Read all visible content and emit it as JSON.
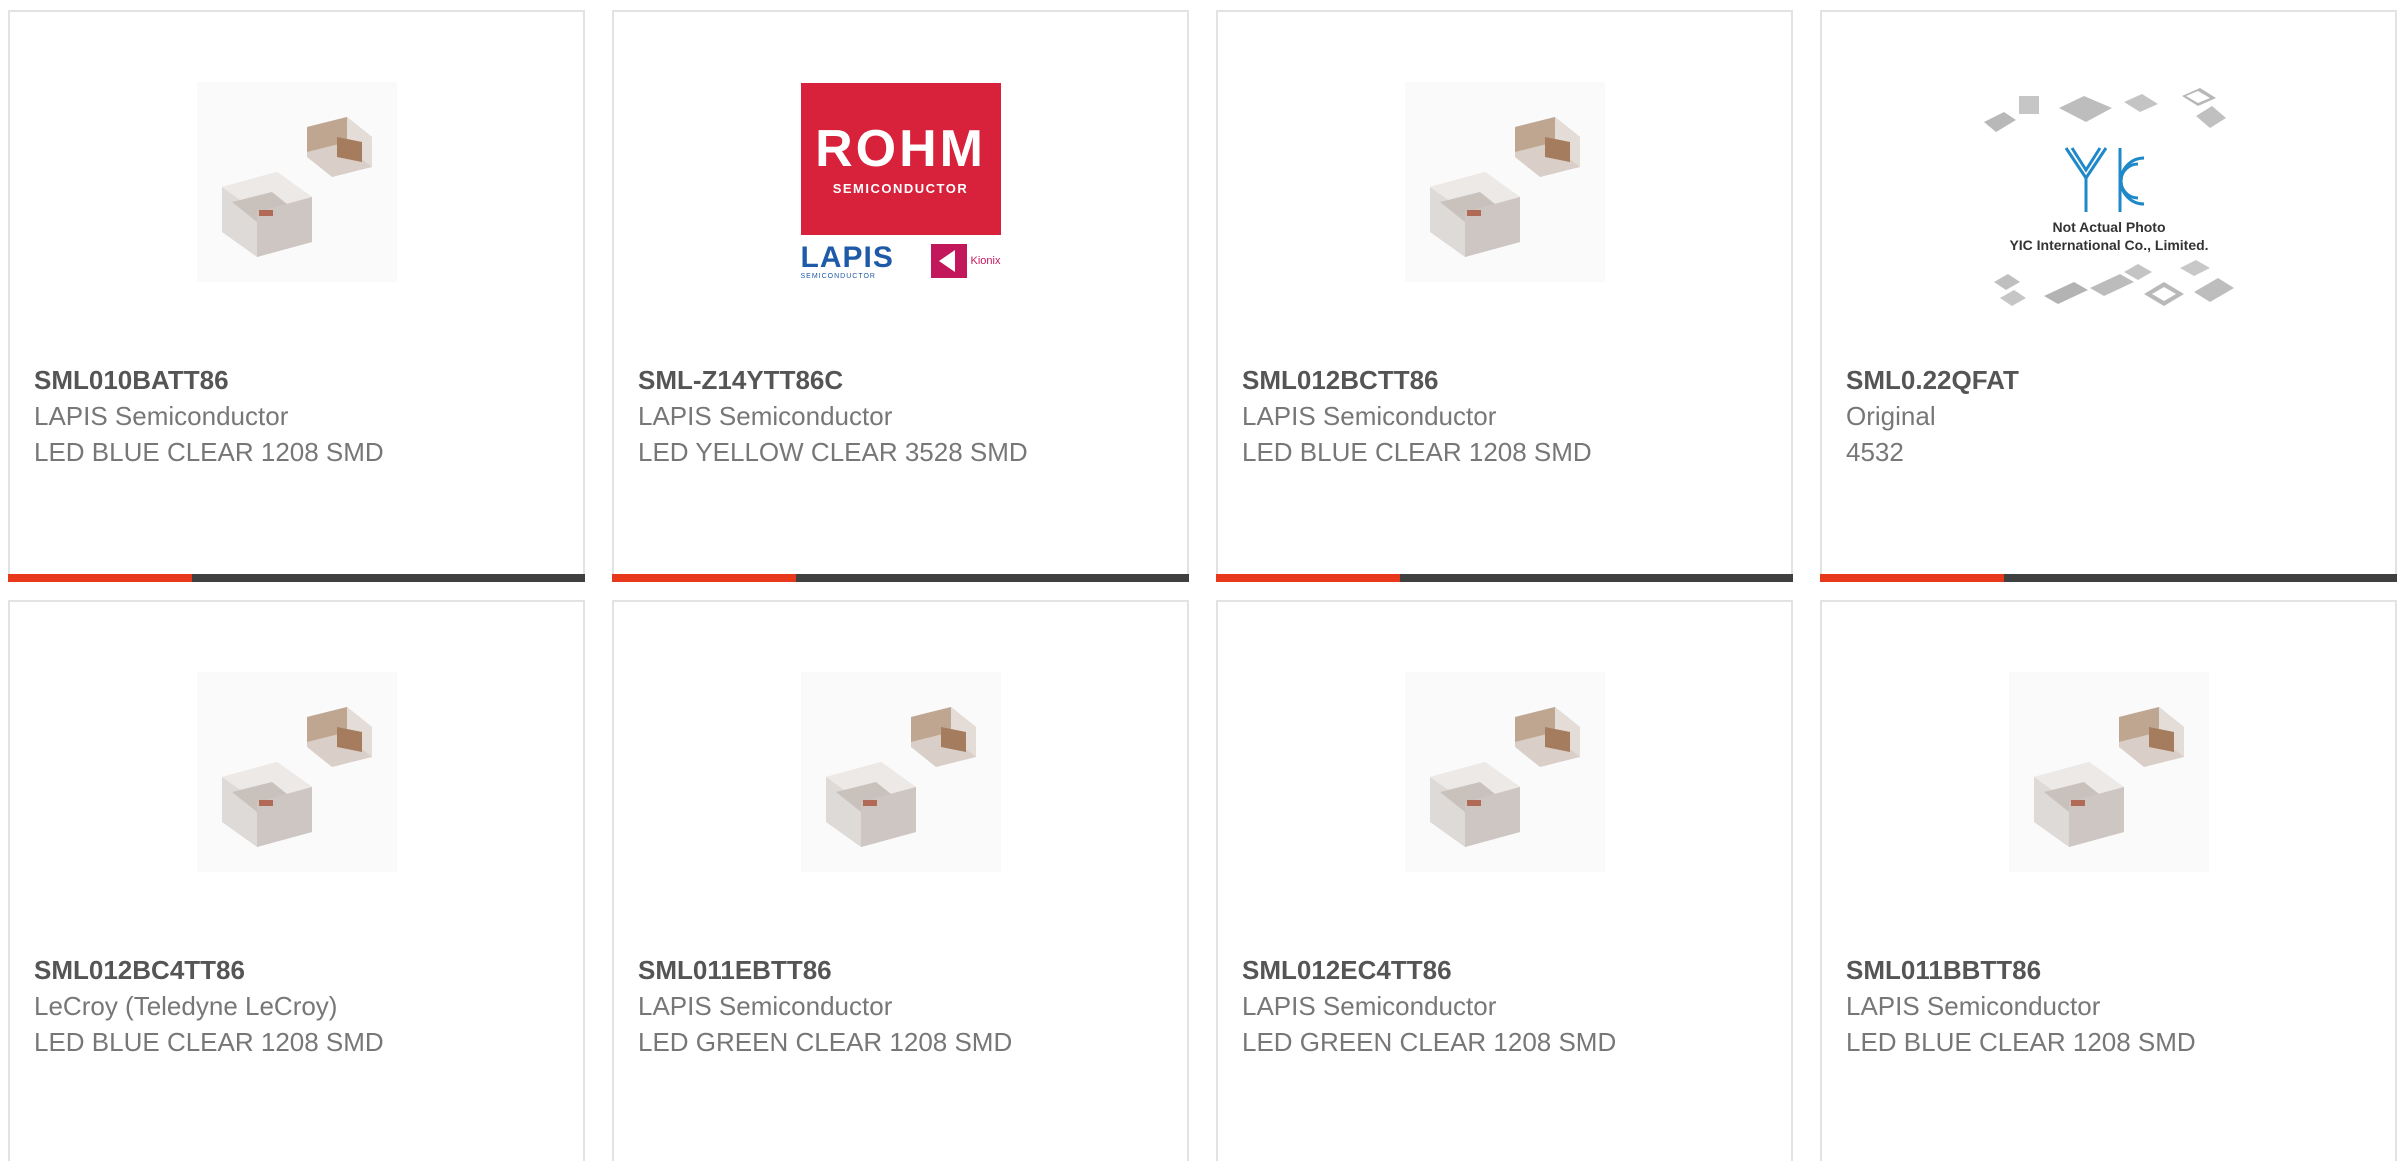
{
  "products": [
    {
      "part_number": "SML010BATT86",
      "manufacturer": "LAPIS Semiconductor",
      "description": "LED BLUE CLEAR 1208 SMD",
      "image": "led-smd-image"
    },
    {
      "part_number": "SML-Z14YTT86C",
      "manufacturer": "LAPIS Semiconductor",
      "description": "LED YELLOW CLEAR 3528 SMD",
      "image": "rohm-logo-image"
    },
    {
      "part_number": "SML012BCTT86",
      "manufacturer": "LAPIS Semiconductor",
      "description": "LED BLUE CLEAR 1208 SMD",
      "image": "led-smd-image"
    },
    {
      "part_number": "SML0.22QFAT",
      "manufacturer": "Original",
      "description": "4532",
      "image": "yic-placeholder-image"
    },
    {
      "part_number": "SML012BC4TT86",
      "manufacturer": "LeCroy (Teledyne LeCroy)",
      "description": "LED BLUE CLEAR 1208 SMD",
      "image": "led-smd-image"
    },
    {
      "part_number": "SML011EBTT86",
      "manufacturer": "LAPIS Semiconductor",
      "description": "LED GREEN CLEAR 1208 SMD",
      "image": "led-smd-image"
    },
    {
      "part_number": "SML012EC4TT86",
      "manufacturer": "LAPIS Semiconductor",
      "description": "LED GREEN CLEAR 1208 SMD",
      "image": "led-smd-image"
    },
    {
      "part_number": "SML011BBTT86",
      "manufacturer": "LAPIS Semiconductor",
      "description": "LED BLUE CLEAR 1208 SMD",
      "image": "led-smd-image"
    }
  ],
  "rohm_logo": {
    "brand": "ROHM",
    "tagline": "SEMICONDUCTOR",
    "lapis": "LAPIS",
    "lapis_sub": "SEMICONDUCTOR",
    "kionix": "Kionix"
  },
  "yic_placeholder": {
    "line1": "Not Actual Photo",
    "line2": "YIC International Co., Limited."
  },
  "colors": {
    "accent": "#e8381b",
    "bar": "#404040",
    "border": "#e3e3e3",
    "title": "#555555",
    "text": "#777777"
  }
}
